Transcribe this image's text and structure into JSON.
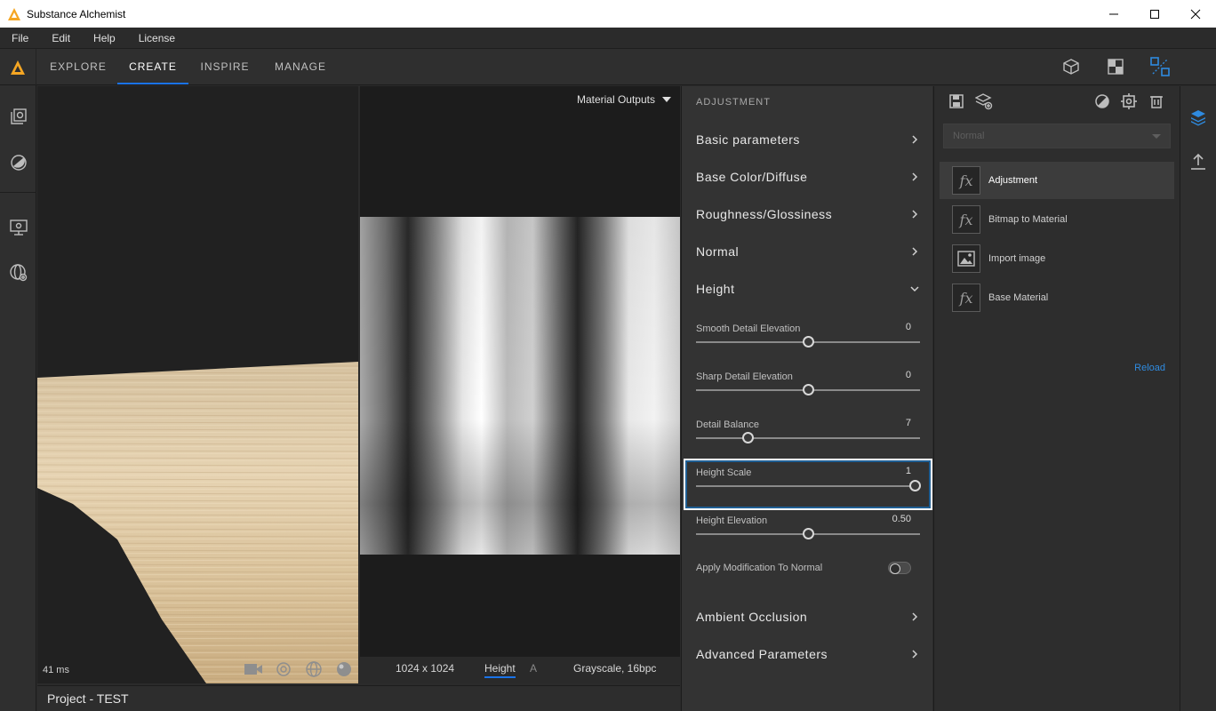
{
  "window": {
    "title": "Substance Alchemist",
    "controls": [
      "minimize-icon",
      "maximize-icon",
      "close-icon"
    ]
  },
  "menu": {
    "items": [
      "File",
      "Edit",
      "Help",
      "License"
    ]
  },
  "nav": {
    "tabs": [
      "EXPLORE",
      "CREATE",
      "INSPIRE",
      "MANAGE"
    ],
    "active_tab": "CREATE",
    "accent": "#1a73e8",
    "right_icons": [
      "cube-view-icon",
      "checker-view-icon",
      "split-view-icon"
    ]
  },
  "left_rail": {
    "icons": [
      "library-icon",
      "material-ball-icon",
      "monitor-settings-icon",
      "globe-settings-icon"
    ]
  },
  "viewport3d": {
    "frame_time": "41 ms",
    "icons": [
      "camera-icon",
      "environment-icon",
      "grid-sphere-icon",
      "sphere-icon"
    ]
  },
  "view2d": {
    "output_selector": "Material Outputs",
    "resolution": "1024 x 1024",
    "channel": "Height",
    "channel_next": "A",
    "format": "Grayscale, 16bpc"
  },
  "project": {
    "label": "Project - TEST"
  },
  "adjustment": {
    "heading": "ADJUSTMENT",
    "sections_top": [
      "Basic parameters",
      "Base Color/Diffuse",
      "Roughness/Glossiness",
      "Normal"
    ],
    "height_section": "Height",
    "params": [
      {
        "label": "Smooth Detail Elevation",
        "value": "0",
        "fraction": 0.5
      },
      {
        "label": "Sharp Detail Elevation",
        "value": "0",
        "fraction": 0.5
      },
      {
        "label": "Detail Balance",
        "value": "7",
        "fraction": 0.23
      },
      {
        "label": "Height Scale",
        "value": "1",
        "fraction": 0.975
      },
      {
        "label": "Height Elevation",
        "value": "0.50",
        "fraction": 0.5
      }
    ],
    "toggle_label": "Apply Modification To Normal",
    "toggle_on": false,
    "sections_bottom": [
      "Ambient Occlusion",
      "Advanced Parameters"
    ]
  },
  "stack": {
    "toolbar_icons": [
      "save-icon",
      "add-layer-icon",
      "mask-icon",
      "substance-settings-icon",
      "trash-icon"
    ],
    "blend_mode": "Normal",
    "layers": [
      {
        "name": "Adjustment",
        "thumb": "fx",
        "active": true
      },
      {
        "name": "Bitmap to Material",
        "thumb": "fx",
        "active": false
      },
      {
        "name": "Import image",
        "thumb": "image",
        "active": false
      },
      {
        "name": "Base Material",
        "thumb": "fx",
        "active": false
      }
    ],
    "reload_label": "Reload"
  },
  "right_rail": {
    "icons": [
      "layers-icon",
      "export-icon"
    ]
  }
}
